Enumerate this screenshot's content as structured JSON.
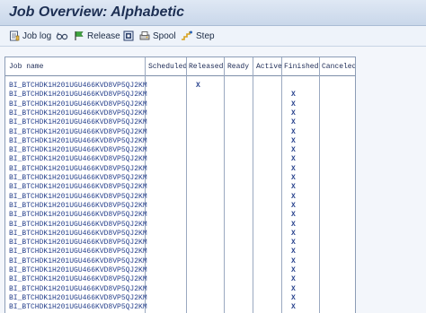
{
  "window": {
    "title": "Job Overview: Alphabetic"
  },
  "toolbar": {
    "items": [
      {
        "label": "Job log",
        "icon": "job-log-icon"
      },
      {
        "label": "",
        "icon": "glasses-icon"
      },
      {
        "label": "Release",
        "icon": "release-flag-icon"
      },
      {
        "label": "",
        "icon": "document-icon"
      },
      {
        "label": "Spool",
        "icon": "spool-icon"
      },
      {
        "label": "Step",
        "icon": "step-icon"
      }
    ]
  },
  "table": {
    "columns": [
      "Job name",
      "Scheduled",
      "Released",
      "Ready",
      "Active",
      "Finished",
      "Canceled"
    ],
    "mark": "X",
    "rows": [
      {
        "name": "BI_BTCHDK1H201UGU466KVD8VP5QJ2KM",
        "status": "Released"
      },
      {
        "name": "BI_BTCHDK1H201UGU466KVD8VP5QJ2KM",
        "status": "Finished"
      },
      {
        "name": "BI_BTCHDK1H201UGU466KVD8VP5QJ2KM",
        "status": "Finished"
      },
      {
        "name": "BI_BTCHDK1H201UGU466KVD8VP5QJ2KM",
        "status": "Finished"
      },
      {
        "name": "BI_BTCHDK1H201UGU466KVD8VP5QJ2KM",
        "status": "Finished"
      },
      {
        "name": "BI_BTCHDK1H201UGU466KVD8VP5QJ2KM",
        "status": "Finished"
      },
      {
        "name": "BI_BTCHDK1H201UGU466KVD8VP5QJ2KM",
        "status": "Finished"
      },
      {
        "name": "BI_BTCHDK1H201UGU466KVD8VP5QJ2KM",
        "status": "Finished"
      },
      {
        "name": "BI_BTCHDK1H201UGU466KVD8VP5QJ2KM",
        "status": "Finished"
      },
      {
        "name": "BI_BTCHDK1H201UGU466KVD8VP5QJ2KM",
        "status": "Finished"
      },
      {
        "name": "BI_BTCHDK1H201UGU466KVD8VP5QJ2KM",
        "status": "Finished"
      },
      {
        "name": "BI_BTCHDK1H201UGU466KVD8VP5QJ2KM",
        "status": "Finished"
      },
      {
        "name": "BI_BTCHDK1H201UGU466KVD8VP5QJ2KM",
        "status": "Finished"
      },
      {
        "name": "BI_BTCHDK1H201UGU466KVD8VP5QJ2KM",
        "status": "Finished"
      },
      {
        "name": "BI_BTCHDK1H201UGU466KVD8VP5QJ2KM",
        "status": "Finished"
      },
      {
        "name": "BI_BTCHDK1H201UGU466KVD8VP5QJ2KM",
        "status": "Finished"
      },
      {
        "name": "BI_BTCHDK1H201UGU466KVD8VP5QJ2KM",
        "status": "Finished"
      },
      {
        "name": "BI_BTCHDK1H201UGU466KVD8VP5QJ2KM",
        "status": "Finished"
      },
      {
        "name": "BI_BTCHDK1H201UGU466KVD8VP5QJ2KM",
        "status": "Finished"
      },
      {
        "name": "BI_BTCHDK1H201UGU466KVD8VP5QJ2KM",
        "status": "Finished"
      },
      {
        "name": "BI_BTCHDK1H201UGU466KVD8VP5QJ2KM",
        "status": "Finished"
      },
      {
        "name": "BI_BTCHDK1H201UGU466KVD8VP5QJ2KM",
        "status": "Finished"
      },
      {
        "name": "BI_BTCHDK1H201UGU466KVD8VP5QJ2KM",
        "status": "Finished"
      },
      {
        "name": "BI_BTCHDK1H201UGU466KVD8VP5QJ2KM",
        "status": "Finished"
      },
      {
        "name": "BI_BTCHDK1H201UGU466KVD8VP5QJ2KM",
        "status": "Finished"
      }
    ]
  }
}
